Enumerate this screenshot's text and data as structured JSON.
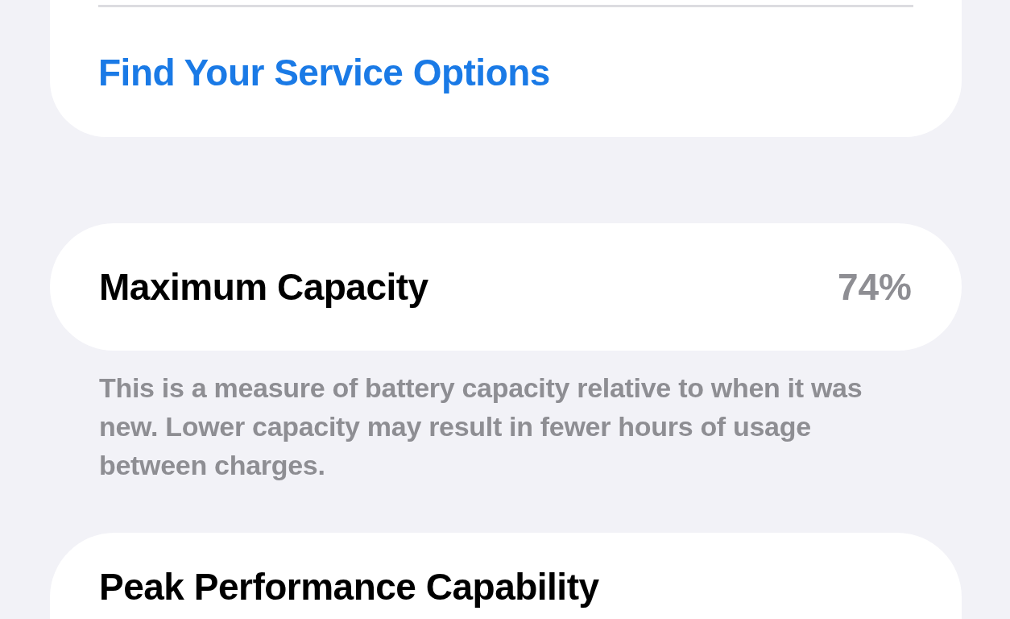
{
  "service_card": {
    "link": "Find Your Service Options"
  },
  "capacity_card": {
    "label": "Maximum Capacity",
    "value": "74%"
  },
  "capacity_note": "This is a measure of battery capacity relative to when it was new. Lower capacity may result in fewer hours of usage between charges.",
  "performance_card": {
    "label": "Peak Performance Capability"
  }
}
